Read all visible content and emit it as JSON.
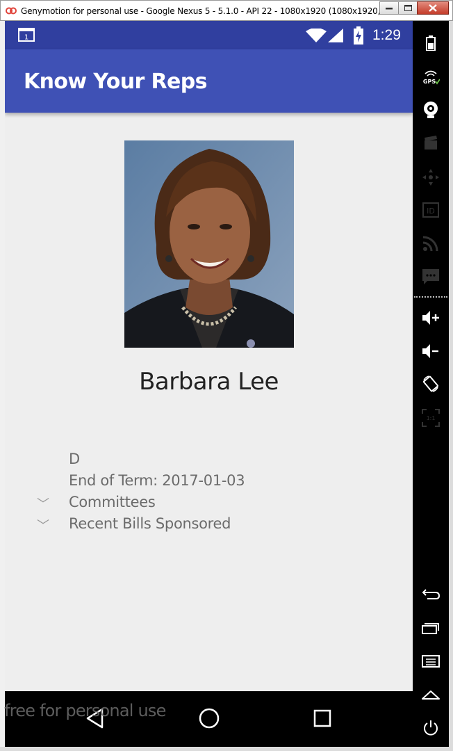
{
  "window": {
    "title": "Genymotion for personal use - Google Nexus 5 - 5.1.0 - API 22 - 1080x1920 (1080x1920, 480d...",
    "buttons": [
      "minimize",
      "maximize",
      "close"
    ]
  },
  "status_bar": {
    "time": "1:29",
    "color": "#303f9f",
    "icons": [
      "notification-icon",
      "wifi-icon",
      "signal-icon",
      "battery-charging-icon"
    ]
  },
  "app_bar": {
    "title": "Know Your Reps",
    "color": "#3f51b5"
  },
  "rep": {
    "name": "Barbara Lee",
    "party": "D",
    "end_of_term": "End of Term: 2017-01-03",
    "sections": [
      {
        "label": "Committees",
        "icon": "chevron-down-icon"
      },
      {
        "label": "Recent Bills Sponsored",
        "icon": "chevron-down-icon"
      }
    ]
  },
  "nav_bar": {
    "buttons": [
      "back-icon",
      "home-icon",
      "recents-icon"
    ]
  },
  "watermark": "free for personal use",
  "sidebar": {
    "tools": [
      "battery-icon",
      "gps-icon",
      "camera-icon",
      "capture-icon",
      "dpad-icon",
      "id-icon",
      "network-icon",
      "sms-icon",
      "volume-up-icon",
      "volume-down-icon",
      "rotate-icon",
      "pixel-perfect-icon",
      "back-icon",
      "recent-apps-icon",
      "menu-icon",
      "home-icon",
      "power-icon"
    ],
    "gps_label": "GPS",
    "pixel_label": "1:1"
  }
}
